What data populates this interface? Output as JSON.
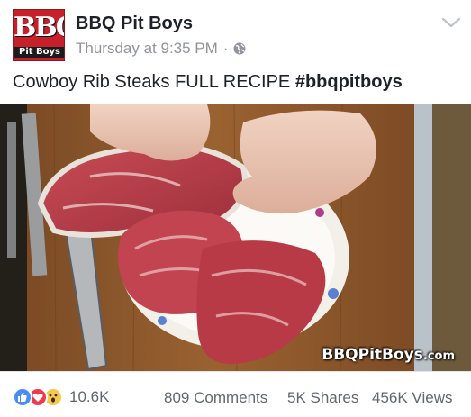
{
  "header": {
    "avatar_text_top": "BBQ",
    "avatar_text_bottom": "Pit Boys",
    "page_name": "BBQ Pit Boys",
    "timestamp": "Thursday at 9:35 PM",
    "separator": "·",
    "privacy_icon": "globe-icon",
    "menu_icon": "chevron-down-icon"
  },
  "post": {
    "text": "Cowboy Rib Steaks FULL RECIPE",
    "hashtag": "#bbqpitboys"
  },
  "media": {
    "watermark_main": "BBQPitBoys",
    "watermark_suffix": ".com"
  },
  "footer": {
    "reaction_icons": [
      "like-icon",
      "love-icon",
      "wow-icon"
    ],
    "reaction_count": "10.6K",
    "comments": "809 Comments",
    "shares": "5K Shares",
    "views": "456K Views"
  },
  "colors": {
    "avatar_red": "#c8202a",
    "meta_gray": "#90949c",
    "like_blue": "#4a8bf7",
    "love_red": "#f0394f",
    "wow_yellow": "#f7c94a"
  }
}
